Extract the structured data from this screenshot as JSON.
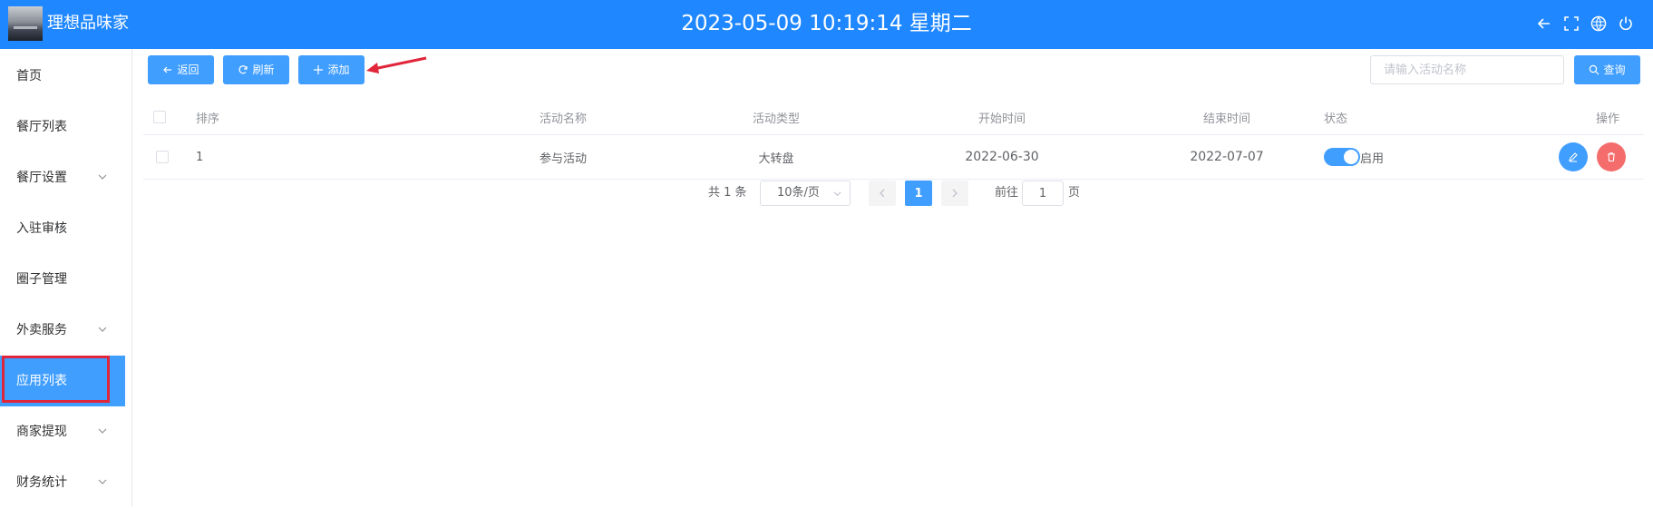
{
  "header": {
    "app_name": "理想品味家",
    "datetime": "2023-05-09 10:19:14 星期二",
    "icons": [
      "back-arrow-icon",
      "fullscreen-icon",
      "language-icon",
      "power-icon"
    ]
  },
  "sidebar": {
    "items": [
      {
        "label": "首页",
        "has_submenu": false
      },
      {
        "label": "餐厅列表",
        "has_submenu": false
      },
      {
        "label": "餐厅设置",
        "has_submenu": true
      },
      {
        "label": "入驻审核",
        "has_submenu": false
      },
      {
        "label": "圈子管理",
        "has_submenu": false
      },
      {
        "label": "外卖服务",
        "has_submenu": true
      },
      {
        "label": "应用列表",
        "has_submenu": false,
        "active": true
      },
      {
        "label": "商家提现",
        "has_submenu": true
      },
      {
        "label": "财务统计",
        "has_submenu": true
      }
    ]
  },
  "toolbar": {
    "back_label": "返回",
    "refresh_label": "刷新",
    "add_label": "添加",
    "search_placeholder": "请输入活动名称",
    "query_label": "查询"
  },
  "table": {
    "columns": [
      "排序",
      "活动名称",
      "活动类型",
      "开始时间",
      "结束时间",
      "状态",
      "操作"
    ],
    "rows": [
      {
        "order": "1",
        "name": "参与活动",
        "type": "大转盘",
        "start": "2022-06-30",
        "end": "2022-07-07",
        "status_label": "启用",
        "status_on": true
      }
    ]
  },
  "pagination": {
    "total_text": "共 1 条",
    "page_size": "10条/页",
    "current_page": "1",
    "goto_prefix": "前往",
    "goto_value": "1",
    "goto_suffix": "页"
  },
  "colors": {
    "header_bg": "#1f87ff",
    "primary": "#409eff",
    "danger": "#f56c6c",
    "annotation_red": "#e0263b"
  }
}
